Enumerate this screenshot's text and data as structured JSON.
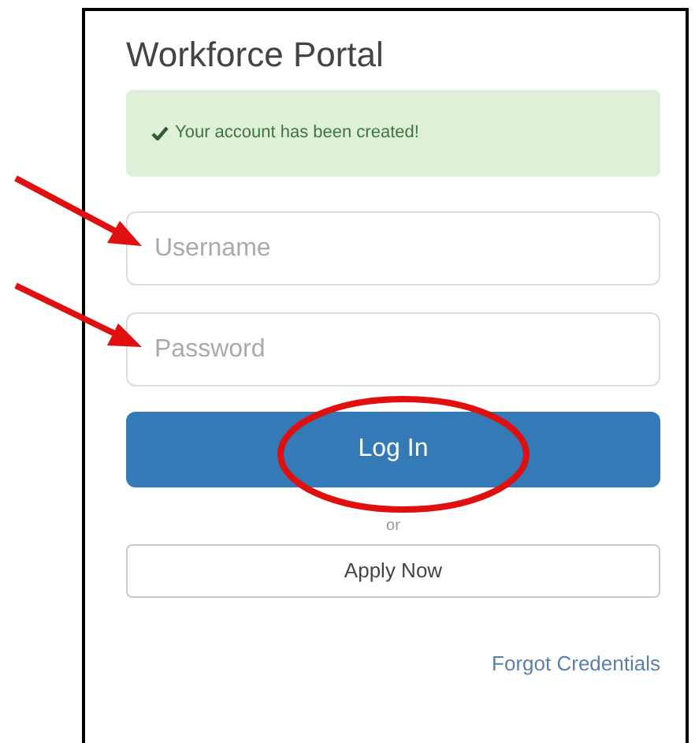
{
  "title": "Workforce Portal",
  "alert": {
    "text": "Your account has been created!"
  },
  "fields": [
    {
      "placeholder": "Username"
    },
    {
      "placeholder": "Password"
    }
  ],
  "login_button": "Log In",
  "separator": "or",
  "apply_button": "Apply Now",
  "forgot_link": "Forgot Credentials"
}
